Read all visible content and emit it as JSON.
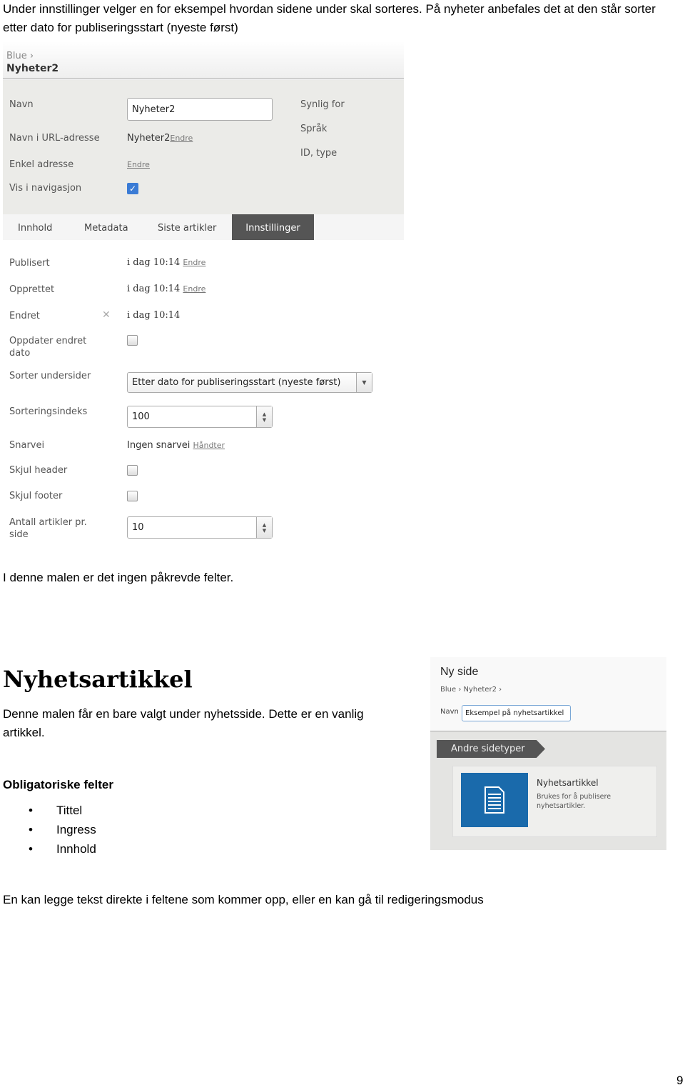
{
  "intro": [
    "Under innstillinger velger en for eksempel hvordan sidene under skal sorteres. På nyheter anbefales det at den står sorter",
    "etter dato for publiseringsstart (nyeste først)"
  ],
  "shot1": {
    "breadcrumb": "Blue",
    "title": "Nyheter2",
    "fields": {
      "navn_label": "Navn",
      "navn_value": "Nyheter2",
      "url_label": "Navn i URL-adresse",
      "url_value": "Nyheter2",
      "url_link": "Endre",
      "enkel_label": "Enkel adresse",
      "enkel_link": "Endre",
      "nav_label": "Vis i navigasjon",
      "nav_checked": true
    },
    "right": [
      "Synlig for",
      "Språk",
      "ID, type"
    ],
    "tabs": [
      "Innhold",
      "Metadata",
      "Siste artikler",
      "Innstillinger"
    ],
    "active_tab": "Innstillinger",
    "settings": {
      "publisert_label": "Publisert",
      "publisert_value": "i dag 10:14",
      "publisert_link": "Endre",
      "opprettet_label": "Opprettet",
      "opprettet_value": "i dag 10:14",
      "opprettet_link": "Endre",
      "endret_label": "Endret",
      "endret_value": "i dag 10:14",
      "oppdater_label": "Oppdater endret dato",
      "sorter_label": "Sorter undersider",
      "sorter_value": "Etter dato for publiseringsstart (nyeste først)",
      "indeks_label": "Sorteringsindeks",
      "indeks_value": "100",
      "snarvei_label": "Snarvei",
      "snarvei_value": "Ingen snarvei",
      "snarvei_link": "Håndter",
      "header_label": "Skjul header",
      "footer_label": "Skjul footer",
      "antall_label": "Antall artikler pr. side",
      "antall_value": "10"
    }
  },
  "no_required": "I denne malen er det ingen påkrevde felter.",
  "heading": "Nyhetsartikkel",
  "desc": "Denne malen får en bare valgt under nyhetsside. Dette er en vanlig artikkel.",
  "required_title": "Obligatoriske felter",
  "required": [
    "Tittel",
    "Ingress",
    "Innhold"
  ],
  "shot2": {
    "title": "Ny side",
    "breadcrumb": [
      "Blue",
      "Nyheter2"
    ],
    "navn_label": "Navn",
    "navn_value": "Eksempel på nyhetsartikkel",
    "section": "Andre sidetyper",
    "card_title": "Nyhetsartikkel",
    "card_desc": "Brukes for å publisere nyhetsartikler.",
    "accent": "#1a6aab"
  },
  "footer_text": "En kan legge tekst direkte i feltene som kommer opp, eller en kan gå til redigeringsmodus",
  "page_number": "9"
}
